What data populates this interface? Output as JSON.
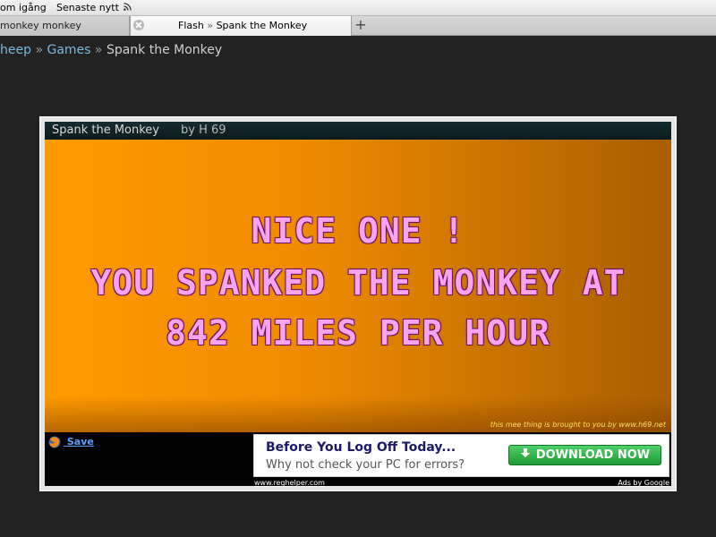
{
  "bookmarks": {
    "items": [
      "om igång",
      "Senaste nytt"
    ]
  },
  "tabs": [
    {
      "label": "monkey monkey"
    },
    {
      "label_site": "Flash",
      "separator": "»",
      "label_page": "Spank the Monkey"
    }
  ],
  "new_tab_label": "+",
  "breadcrumb": {
    "items": [
      "heep",
      "Games",
      "Spank the Monkey"
    ],
    "separator": "»"
  },
  "game": {
    "title": "Spank the Monkey",
    "author": "by H 69",
    "message_lines": [
      "NICE ONE !",
      "YOU SPANKED THE MONKEY AT",
      "842 MILES PER HOUR"
    ],
    "credit": "this mee thing is brought to you by www.h69.net",
    "save_label": "Save",
    "speed_mph": 842
  },
  "ad": {
    "headline": "Before You Log Off Today...",
    "subline": "Why not check your PC for errors?",
    "button_label": "DOWNLOAD NOW",
    "url": "www.reghelper.com",
    "ads_by": "Ads by Google"
  },
  "colors": {
    "page_bg": "#222222",
    "link": "#7ab9e0",
    "stage_orange": "#ff9a00",
    "message_pink": "#f7a4f0",
    "download_green": "#1e9a32"
  }
}
